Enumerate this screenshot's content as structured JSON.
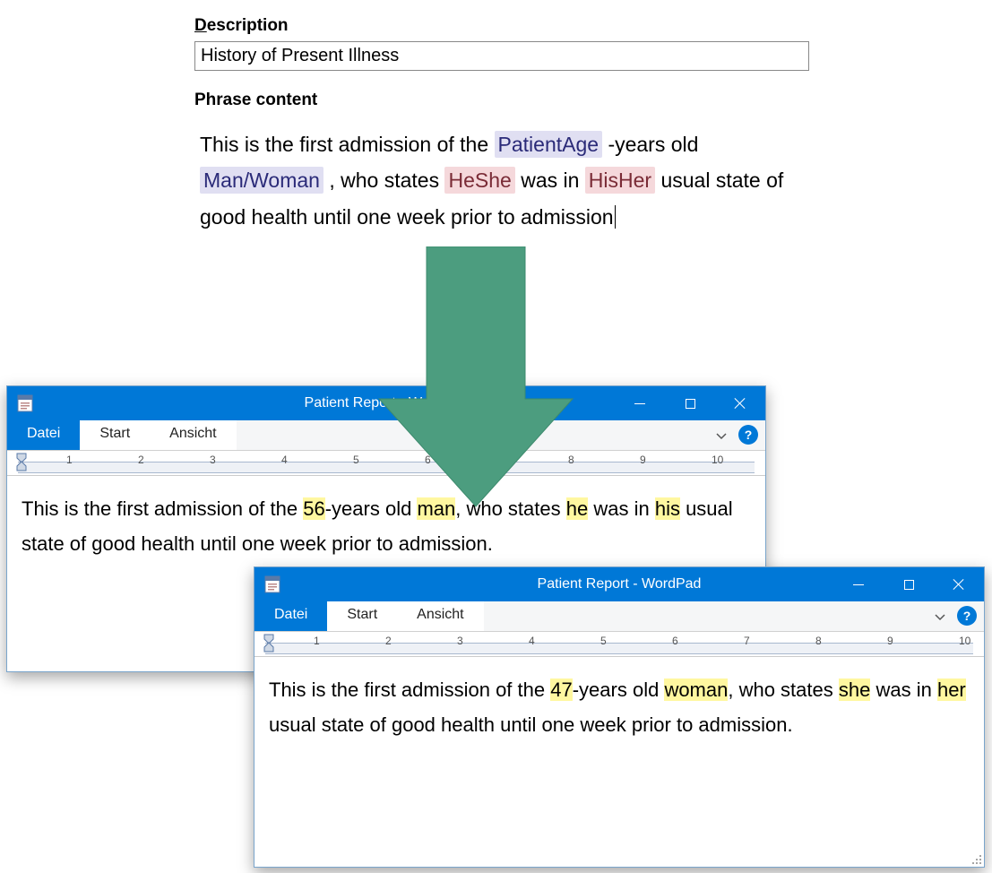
{
  "form": {
    "description_label_html": "Description",
    "description_label_prefix": "D",
    "description_label_rest": "escription",
    "description_value": "History of Present Illness",
    "phrase_content_label": "Phrase content",
    "phrase_text_before_age": "This is the first admission of the ",
    "tag_patient_age": "PatientAge",
    "phrase_after_age": " -years old ",
    "tag_man_woman": "Man/Woman",
    "phrase_who_states": " , who states ",
    "tag_he_she": "HeShe",
    "phrase_was_in": " was in ",
    "tag_his_her": "HisHer",
    "phrase_tail": " usual state of good health until one week prior to admission"
  },
  "wordpad": {
    "title": "Patient Report - WordPad",
    "tabs": {
      "datei": "Datei",
      "start": "Start",
      "ansicht": "Ansicht"
    },
    "help_symbol": "?",
    "ruler_numbers": [
      "1",
      "2",
      "3",
      "4",
      "5",
      "6",
      "7",
      "8",
      "9",
      "10"
    ]
  },
  "output1": {
    "text_pre_age": "This is the first admission of the ",
    "age": "56",
    "text_years_old": "-years old ",
    "gender": "man",
    "text_who_states": ", who states ",
    "heshe": "he",
    "text_was_in": " was in ",
    "hisher": "his",
    "text_tail_visible": " usual state of good health until one week prior to admission."
  },
  "output2": {
    "text_pre_age": "This is the first admission of the ",
    "age": "47",
    "text_years_old": "-years old ",
    "gender": "woman",
    "text_who_states": ", who states ",
    "heshe": "she",
    "text_was_in": " was in ",
    "hisher": "her",
    "text_tail": " usual state of good health until one week prior to admission."
  }
}
